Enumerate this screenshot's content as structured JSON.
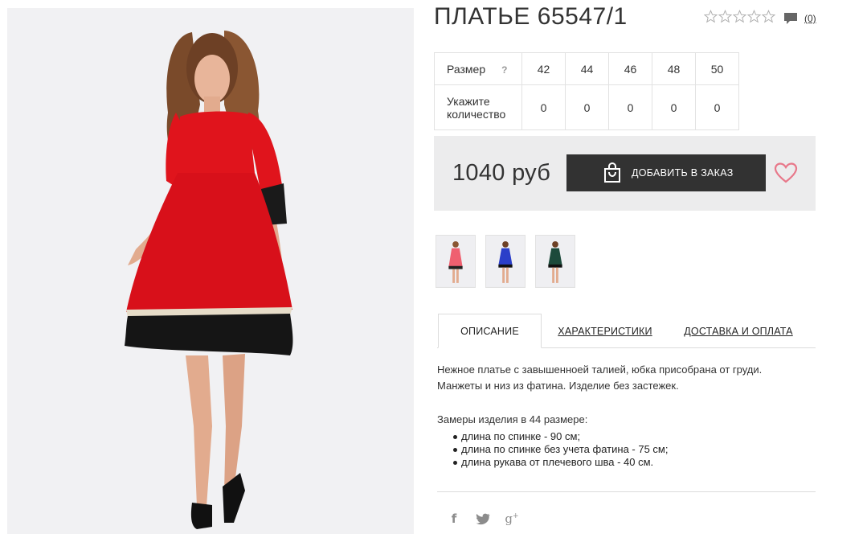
{
  "product": {
    "title": "ПЛАТЬЕ 65547/1",
    "rating_stars": 5,
    "rating_value": 0,
    "comment_count": "(0)",
    "price": "1040 руб",
    "add_to_cart_label": "ДОБАВИТЬ В ЗАКАЗ",
    "dress_color": "#e0141c",
    "icons": [
      "star-icon",
      "comment-icon",
      "bag-icon",
      "heart-icon",
      "facebook-icon",
      "twitter-icon",
      "google-plus-icon"
    ]
  },
  "size_table": {
    "size_label": "Размер",
    "help": "?",
    "qty_label_1": "Укажите",
    "qty_label_2": "количество",
    "sizes": [
      "42",
      "44",
      "46",
      "48",
      "50"
    ],
    "quantities": [
      "0",
      "0",
      "0",
      "0",
      "0"
    ]
  },
  "thumbnails": [
    {
      "color": "#ef6070"
    },
    {
      "color": "#2b3fc9"
    },
    {
      "color": "#1c4a3b"
    }
  ],
  "tabs": {
    "description": "ОПИСАНИЕ",
    "characteristics": "ХАРАКТЕРИСТИКИ",
    "delivery": "ДОСТАВКА И ОПЛАТА"
  },
  "description": {
    "line1": "Нежное платье с завышенноей талией, юбка присобрана от груди.",
    "line2": "Манжеты и низ из фатина. Изделие без застежек.",
    "measure_title": "Замеры изделия в 44 размере:",
    "measures": [
      "длина по спинке - 90 см;",
      "длина по спинке без учета фатина - 75 см;",
      "длина рукава от плечевого шва - 40 см."
    ]
  },
  "social": {
    "facebook": "f",
    "twitter": "🐦",
    "gplus": "g",
    "gplus_sup": "+"
  }
}
